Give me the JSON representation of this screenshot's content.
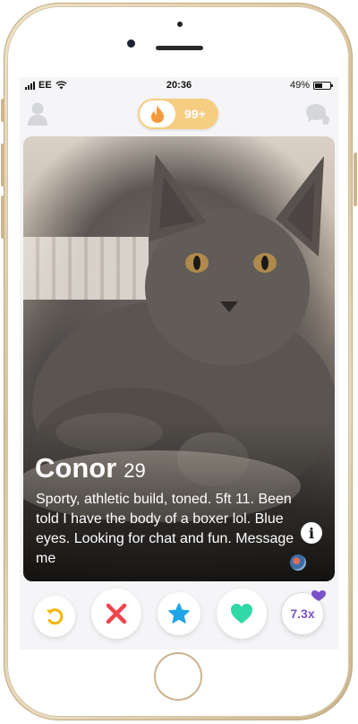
{
  "status_bar": {
    "carrier": "EE",
    "time": "20:36",
    "battery_percent": "49%",
    "battery_level": 0.49
  },
  "top_nav": {
    "profile_icon": "user-profile-icon",
    "chat_icon": "chat-bubbles-icon",
    "toggle_icon": "flame-icon",
    "likes_count": "99+"
  },
  "card": {
    "name": "Conor",
    "age": "29",
    "bio": "Sporty, athletic build, toned. 5ft 11. Been told I have the body of a boxer lol.  Blue eyes. Looking for chat and fun. Message me",
    "info_label": "i"
  },
  "actions": {
    "rewind_icon": "rewind-icon",
    "nope_icon": "close-icon",
    "super_like_icon": "star-icon",
    "like_icon": "heart-icon",
    "boost_label": "7.3x"
  },
  "colors": {
    "flame": "#f59a3c",
    "toggle_bg": "#f7cd82",
    "rewind": "#f5b400",
    "nope": "#f0444b",
    "super_like": "#1fa5e8",
    "like": "#2fd9a5",
    "boost": "#7a52c8"
  }
}
